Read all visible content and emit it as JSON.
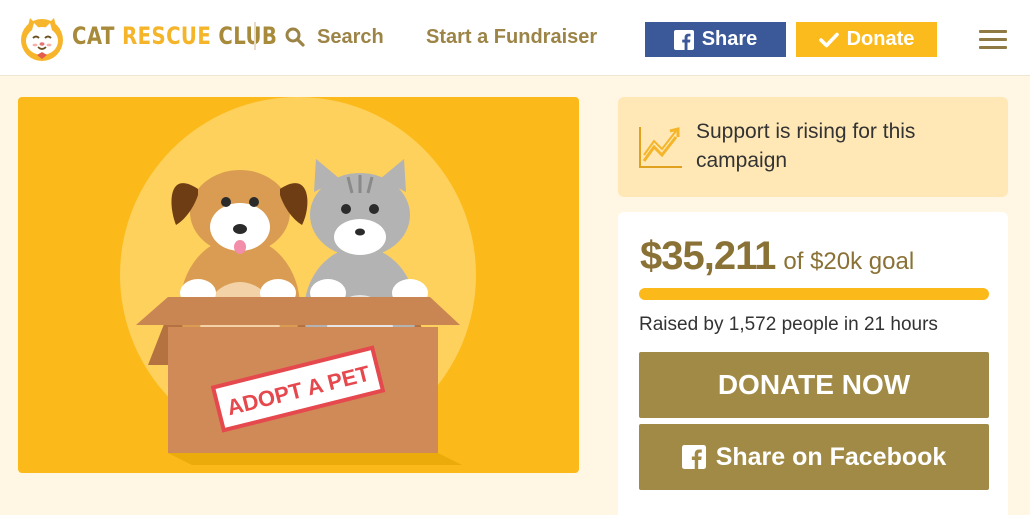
{
  "header": {
    "brand_left": "CAT ",
    "brand_mid": "RESCUE",
    "brand_right": " CLUB",
    "search_label": "Search",
    "fundraiser_label": "Start a Fundraiser",
    "share_label": "Share",
    "donate_label": "Donate"
  },
  "hero": {
    "sign_text": "ADOPT A PET"
  },
  "support": {
    "text": "Support is rising for this campaign"
  },
  "campaign": {
    "amount": "$35,211",
    "goal": "of $20k goal",
    "progress_fraction": 1.0,
    "raised_text": "Raised by 1,572 people in 21 hours",
    "donate_now_label": "DONATE NOW",
    "share_fb_label": "Share on Facebook"
  },
  "colors": {
    "accent_yellow": "#fcb91a",
    "brand_brown": "#a08a45",
    "facebook_blue": "#3b5998",
    "background": "#fff7e3"
  },
  "icons": [
    "cat-logo-icon",
    "search-icon",
    "facebook-icon",
    "check-icon",
    "hamburger-icon",
    "trending-up-icon"
  ]
}
